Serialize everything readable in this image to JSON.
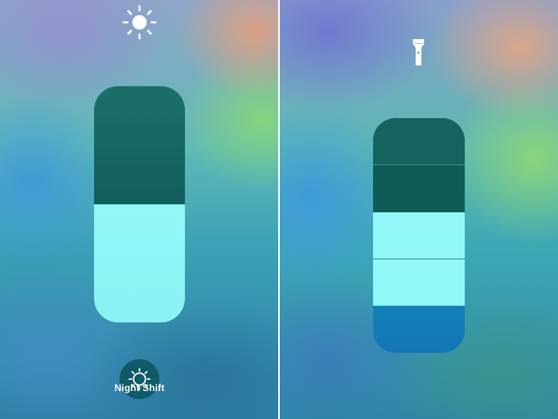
{
  "left_panel": {
    "brightness": {
      "icon": "sun-icon",
      "level_fraction": 0.5
    },
    "night_shift": {
      "icon": "night-shift-icon",
      "label": "Night Shift"
    }
  },
  "right_panel": {
    "flashlight": {
      "icon": "flashlight-icon",
      "level_steps": 2,
      "total_steps": 4
    }
  },
  "colors": {
    "slider_fill": "#92f7f7",
    "slider_track": "#0f5a56",
    "night_shift_button": "#0f5a66",
    "flashlight_base": "#1376b5"
  }
}
